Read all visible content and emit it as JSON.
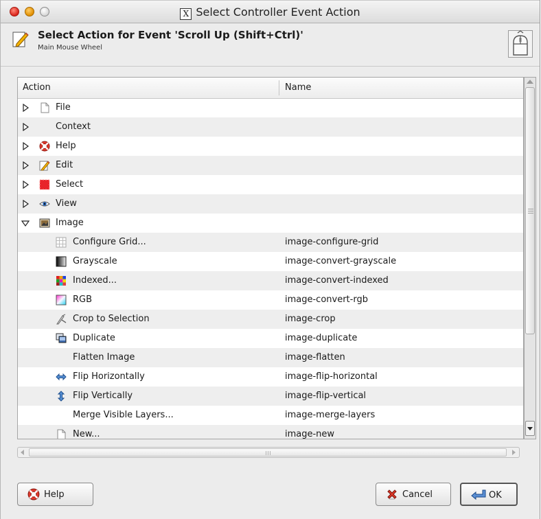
{
  "window": {
    "title": "Select Controller Event Action"
  },
  "header": {
    "title": "Select Action for Event 'Scroll Up (Shift+Ctrl)'",
    "subtitle": "Main Mouse Wheel"
  },
  "tree": {
    "columns": [
      "Action",
      "Name"
    ],
    "rows": [
      {
        "label": "File",
        "name": "",
        "icon": "file-icon",
        "expander": "collapsed"
      },
      {
        "label": "Context",
        "name": "",
        "icon": "",
        "expander": "collapsed"
      },
      {
        "label": "Help",
        "name": "",
        "icon": "help-lifebuoy-icon",
        "expander": "collapsed"
      },
      {
        "label": "Edit",
        "name": "",
        "icon": "edit-icon",
        "expander": "collapsed"
      },
      {
        "label": "Select",
        "name": "",
        "icon": "select-icon",
        "expander": "collapsed"
      },
      {
        "label": "View",
        "name": "",
        "icon": "eye-icon",
        "expander": "collapsed"
      },
      {
        "label": "Image",
        "name": "",
        "icon": "image-icon",
        "expander": "expanded"
      },
      {
        "label": "Configure Grid...",
        "name": "image-configure-grid",
        "icon": "grid-icon"
      },
      {
        "label": "Grayscale",
        "name": "image-convert-grayscale",
        "icon": "grayscale-icon"
      },
      {
        "label": "Indexed...",
        "name": "image-convert-indexed",
        "icon": "indexed-icon"
      },
      {
        "label": "RGB",
        "name": "image-convert-rgb",
        "icon": "rgb-icon"
      },
      {
        "label": "Crop to Selection",
        "name": "image-crop",
        "icon": "crop-icon"
      },
      {
        "label": "Duplicate",
        "name": "image-duplicate",
        "icon": "duplicate-icon"
      },
      {
        "label": "Flatten Image",
        "name": "image-flatten",
        "icon": ""
      },
      {
        "label": "Flip Horizontally",
        "name": "image-flip-horizontal",
        "icon": "flip-horizontal-icon"
      },
      {
        "label": "Flip Vertically",
        "name": "image-flip-vertical",
        "icon": "flip-vertical-icon"
      },
      {
        "label": "Merge Visible Layers...",
        "name": "image-merge-layers",
        "icon": ""
      },
      {
        "label": "New...",
        "name": "image-new",
        "icon": "file-icon"
      }
    ]
  },
  "buttons": {
    "help": "Help",
    "cancel": "Cancel",
    "ok": "OK"
  }
}
